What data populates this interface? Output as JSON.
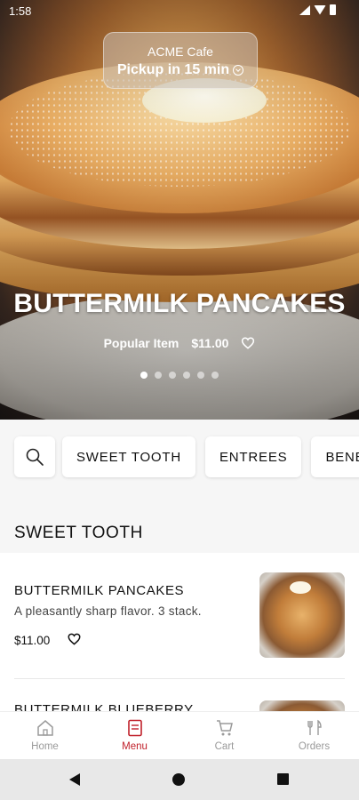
{
  "status_bar": {
    "time": "1:58"
  },
  "store": {
    "name": "ACME Cafe",
    "pickup": "Pickup in 15 min"
  },
  "hero": {
    "title": "BUTTERMILK PANCAKES",
    "badge": "Popular Item",
    "price": "$11.00",
    "carousel": {
      "total": 6,
      "active_index": 0
    }
  },
  "categories": [
    "SWEET TOOTH",
    "ENTREES",
    "BENED"
  ],
  "section": {
    "title": "SWEET TOOTH"
  },
  "menu_items": [
    {
      "name": "BUTTERMILK PANCAKES",
      "description": "A pleasantly sharp flavor.  3 stack.",
      "price": "$11.00"
    },
    {
      "name": "BUTTERMILK BLUEBERRY"
    }
  ],
  "bottom_nav": [
    {
      "label": "Home",
      "icon": "home-icon"
    },
    {
      "label": "Menu",
      "icon": "menu-icon"
    },
    {
      "label": "Cart",
      "icon": "cart-icon"
    },
    {
      "label": "Orders",
      "icon": "utensils-icon"
    }
  ],
  "colors": {
    "accent": "#c0202a"
  }
}
